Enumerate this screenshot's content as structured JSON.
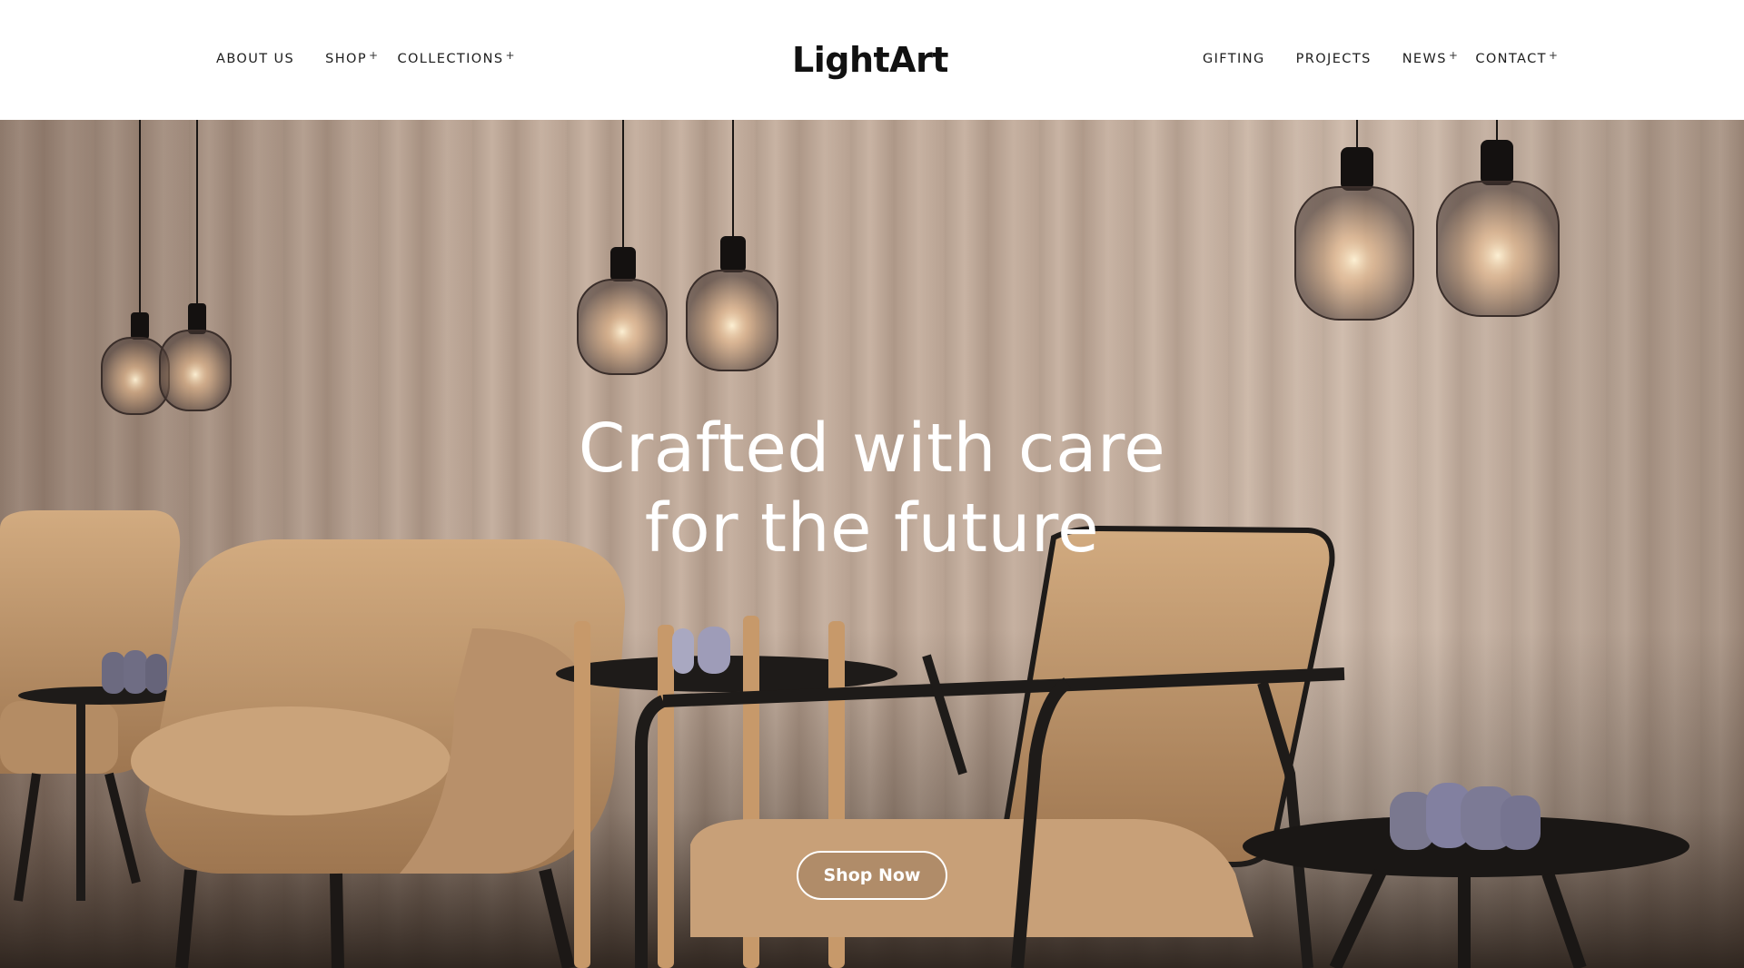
{
  "header": {
    "logo": "LightArt",
    "nav_left": [
      {
        "label": "ABOUT US",
        "has_plus": false
      },
      {
        "label": "SHOP",
        "has_plus": true
      },
      {
        "label": "COLLECTIONS",
        "has_plus": true
      }
    ],
    "nav_right": [
      {
        "label": "GIFTING",
        "has_plus": false
      },
      {
        "label": "PROJECTS",
        "has_plus": false
      },
      {
        "label": "NEWS",
        "has_plus": true
      },
      {
        "label": "CONTACT",
        "has_plus": true
      }
    ],
    "plus_glyph": "+"
  },
  "hero": {
    "heading_line1": "Crafted with care",
    "heading_line2": "for the future",
    "cta_label": "Shop Now",
    "image_subject": "pendant-lamps-lounge-chairs"
  },
  "colors": {
    "header_bg": "#ffffff",
    "text_dark": "#1d1d1d",
    "hero_text": "#ffffff",
    "curtain": "#bba595",
    "leather": "#c39a6e",
    "metal": "#1e1b19"
  }
}
